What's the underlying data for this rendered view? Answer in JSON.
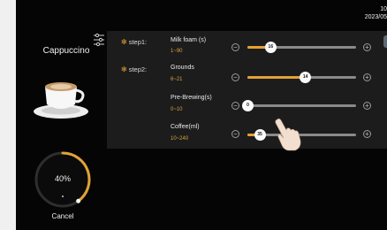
{
  "clock": {
    "time": "10",
    "date": "2023/05"
  },
  "drink": {
    "name": "Cappuccino"
  },
  "progress": {
    "value": 40,
    "label": "40%"
  },
  "cancel_label": "Cancel",
  "steps": [
    {
      "label": "step1:"
    },
    {
      "label": "step2:"
    }
  ],
  "params": [
    {
      "name": "Milk foam (s)",
      "range": "1~90",
      "value": "16",
      "fraction": 0.21
    },
    {
      "name": "Grounds",
      "range": "6~21",
      "value": "14",
      "fraction": 0.53
    },
    {
      "name": "Pre-Brewing(s)",
      "range": "0~10",
      "value": "0",
      "fraction": 0.0
    },
    {
      "name": "Coffee(ml)",
      "range": "10~240",
      "value": "35",
      "fraction": 0.11
    }
  ],
  "colors": {
    "accent": "#e2a237",
    "panel": "#1c1c1c",
    "background": "#050505"
  }
}
